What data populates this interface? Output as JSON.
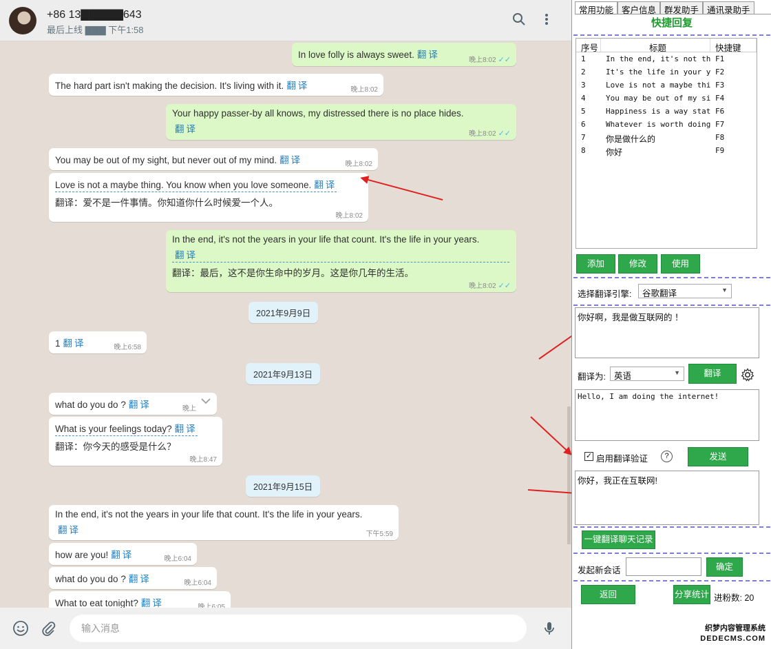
{
  "header": {
    "contact_name": "+86 13▇▇▇▇▇643",
    "status": "最后上线 ▇▇▇ 下午1:58"
  },
  "messages": [
    {
      "text": "In love folly is always sweet.",
      "tr": "翻译",
      "time": "晚上8:02",
      "ticks": "✓✓"
    },
    {
      "text": "The hard part isn't making the decision. It's living with it.",
      "tr": "翻译",
      "time": "晚上8:02"
    },
    {
      "text": "Your happy passer-by all knows, my distressed there is no place hides.",
      "tr": "翻译",
      "time": "晚上8:02",
      "ticks": "✓✓"
    },
    {
      "text": "You may be out of my sight, but never out of my mind.",
      "tr": "翻译",
      "time": "晚上8:02"
    },
    {
      "text": "Love is not a maybe thing. You know when you love someone.",
      "tr": "翻译",
      "translation": "翻译：爱不是一件事情。你知道你什么时候爱一个人。",
      "time": "晚上8:02"
    },
    {
      "text": "In the end, it's not the years in your life that count. It's the life in your years.",
      "tr": "翻译",
      "translation": "翻译：最后，这不是你生命中的岁月。这是你几年的生活。",
      "time": "晚上8:02",
      "ticks": "✓✓"
    },
    {
      "text": "1",
      "tr": "翻译",
      "time": "晚上6:58"
    },
    {
      "text": "what do you do ?",
      "tr": "翻译",
      "time": "晚上"
    },
    {
      "text": "What is your feelings today?",
      "tr": "翻译",
      "translation": "翻译：你今天的感受是什么？",
      "time": "晚上8:47"
    },
    {
      "text": "In the end, it's not the years in your life that count. It's the life in your years.",
      "tr": "翻译",
      "time": "下午5:59"
    },
    {
      "text": "how are you!",
      "tr": "翻译",
      "time": "晚上6:04"
    },
    {
      "text": "what do you do ?",
      "tr": "翻译",
      "time": "晚上6:04"
    },
    {
      "text": "What to eat tonight?",
      "tr": "翻译",
      "time": "晚上6:05"
    }
  ],
  "dates": [
    "2021年9月9日",
    "2021年9月13日",
    "2021年9月15日"
  ],
  "input": {
    "placeholder": "输入消息"
  },
  "side": {
    "tabs": [
      "常用功能",
      "客户信息",
      "群发助手",
      "通讯录助手"
    ],
    "quick_title": "快捷回复",
    "columns": [
      "序号",
      "标题",
      "快捷键"
    ],
    "rows": [
      {
        "no": "1",
        "title": "In the end, it's not the",
        "key": "F1"
      },
      {
        "no": "2",
        "title": "It's the life in your years",
        "key": "F2"
      },
      {
        "no": "3",
        "title": "Love is not a maybe thing",
        "key": "F3"
      },
      {
        "no": "4",
        "title": "You may be out of my sight",
        "key": "F4"
      },
      {
        "no": "5",
        "title": "Happiness is a way station",
        "key": "F6"
      },
      {
        "no": "6",
        "title": "Whatever is worth doing is",
        "key": "F7"
      },
      {
        "no": "7",
        "title": "你是做什么的",
        "key": "F8"
      },
      {
        "no": "8",
        "title": "你好",
        "key": "F9"
      }
    ],
    "btn_add": "添加",
    "btn_edit": "修改",
    "btn_use": "使用",
    "engine_label": "选择翻译引擎:",
    "engine_value": "谷歌翻译",
    "source_text": "你好啊，我是做互联网的 ！",
    "translate_to_label": "翻译为:",
    "translate_to_value": "英语",
    "btn_translate": "翻译",
    "result_text": "Hello, I am doing the internet!",
    "verify_label": "启用翻译验证",
    "verify_checked": "✓",
    "help": "?",
    "btn_send": "发送",
    "verify_text": "你好，我正在互联网!",
    "btn_translate_history": "一键翻译聊天记录",
    "new_chat_label": "发起新会话",
    "btn_confirm": "确定",
    "btn_back": "返回",
    "btn_share": "分享统计",
    "fans_label": "进粉数:",
    "fans_count": "20"
  },
  "watermark": {
    "line1": "织梦内容管理系统",
    "line2": "DEDECMS.COM"
  }
}
